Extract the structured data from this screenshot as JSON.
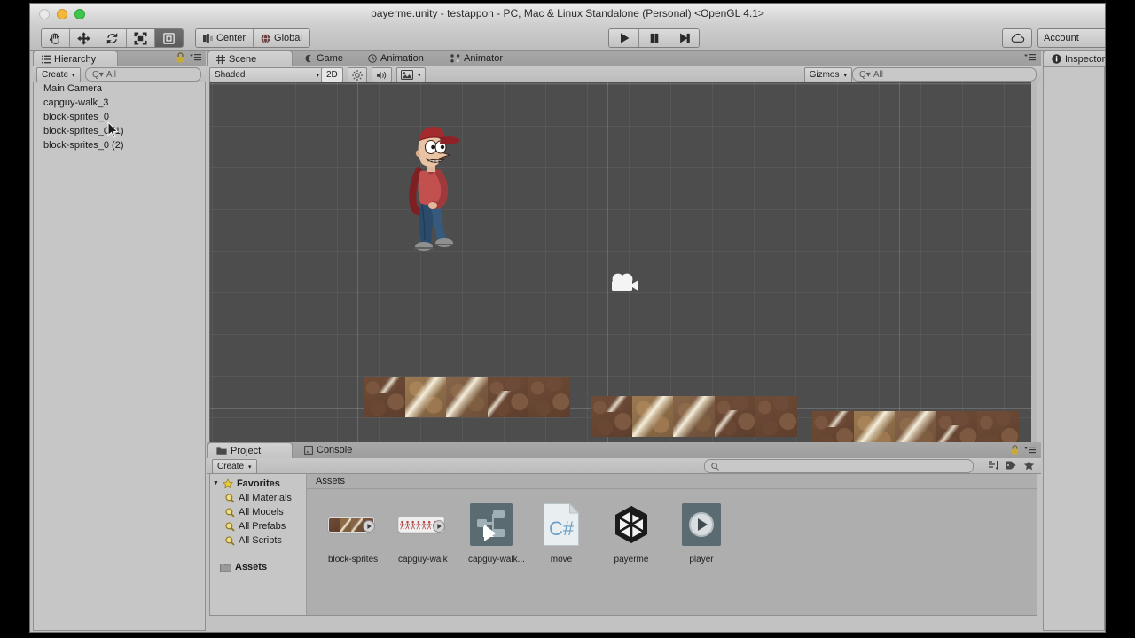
{
  "window": {
    "title": "payerme.unity - testappon - PC, Mac & Linux Standalone (Personal) <OpenGL 4.1>",
    "close_label": "close-button",
    "minimize_label": "minimize-button",
    "zoom_label": "zoom-button"
  },
  "toolbar": {
    "tools": [
      {
        "id": "hand-tool",
        "selected": false
      },
      {
        "id": "move-tool",
        "selected": false
      },
      {
        "id": "rotate-tool",
        "selected": false
      },
      {
        "id": "scale-tool",
        "selected": false
      },
      {
        "id": "rect-tool",
        "selected": true
      }
    ],
    "pivot_label": "Center",
    "space_label": "Global",
    "play_label": "Play",
    "pause_label": "Pause",
    "step_label": "Step",
    "cloud_label": "Unity Cloud",
    "account_label": "Account",
    "account_arrow": "▾"
  },
  "hierarchy": {
    "tab_label": "Hierarchy",
    "create_label": "Create",
    "create_arrow": "▾",
    "search_value": "All",
    "search_prefix": "Q▾",
    "lock_label": "lock-icon",
    "menu_label": "panel-menu-icon",
    "items": [
      {
        "label": "Main Camera"
      },
      {
        "label": "capguy-walk_3"
      },
      {
        "label": "block-sprites_0"
      },
      {
        "label": "block-sprites_0 (1)"
      },
      {
        "label": "block-sprites_0 (2)"
      }
    ]
  },
  "scene": {
    "tabs": [
      {
        "label": "Scene",
        "active": true
      },
      {
        "label": "Game",
        "active": false
      },
      {
        "label": "Animation",
        "active": false
      },
      {
        "label": "Animator",
        "active": false
      }
    ],
    "draw_mode": "Shaded",
    "draw_mode_arrow": "▾",
    "mode_2d": "2D",
    "lighting_label": "lighting-toggle",
    "audio_label": "audio-toggle",
    "effects_label": "effects-toggle",
    "effects_arrow": "▾",
    "gizmos_label": "Gizmos",
    "gizmos_arrow": "▾",
    "search_value": "All",
    "search_prefix": "Q▾",
    "menu_label": "panel-menu-icon",
    "background_color": "#4d4d4d",
    "objects": [
      {
        "name": "capguy-walk_3",
        "type": "sprite"
      },
      {
        "name": "Main Camera",
        "type": "camera-gizmo"
      },
      {
        "name": "block-sprites_0",
        "type": "platform",
        "tiles": 5
      },
      {
        "name": "block-sprites_0 (1)",
        "type": "platform",
        "tiles": 5
      },
      {
        "name": "block-sprites_0 (2)",
        "type": "platform",
        "tiles": 5
      }
    ]
  },
  "project": {
    "tabs": [
      {
        "label": "Project",
        "active": true
      },
      {
        "label": "Console",
        "active": false
      }
    ],
    "create_label": "Create",
    "create_arrow": "▾",
    "search_value": "",
    "lock_label": "lock-icon",
    "menu_label": "panel-menu-icon",
    "breadcrumb": "Assets",
    "tree": [
      {
        "label": "Favorites",
        "icon": "star-icon",
        "expanded": true,
        "depth": 0
      },
      {
        "label": "All Materials",
        "icon": "search-icon",
        "depth": 1
      },
      {
        "label": "All Models",
        "icon": "search-icon",
        "depth": 1
      },
      {
        "label": "All Prefabs",
        "icon": "search-icon",
        "depth": 1
      },
      {
        "label": "All Scripts",
        "icon": "search-icon",
        "depth": 1
      },
      {
        "label": "Assets",
        "icon": "folder-icon",
        "depth": 0
      }
    ],
    "assets": [
      {
        "label": "block-sprites",
        "icon": "spritesheet-blocks-icon"
      },
      {
        "label": "capguy-walk",
        "icon": "spritesheet-capguy-icon"
      },
      {
        "label": "capguy-walk...",
        "icon": "animator-controller-icon"
      },
      {
        "label": "move",
        "icon": "csharp-script-icon"
      },
      {
        "label": "payerme",
        "icon": "unity-scene-icon"
      },
      {
        "label": "player",
        "icon": "animation-clip-icon"
      }
    ]
  },
  "inspector": {
    "tab_label": "Inspector"
  }
}
